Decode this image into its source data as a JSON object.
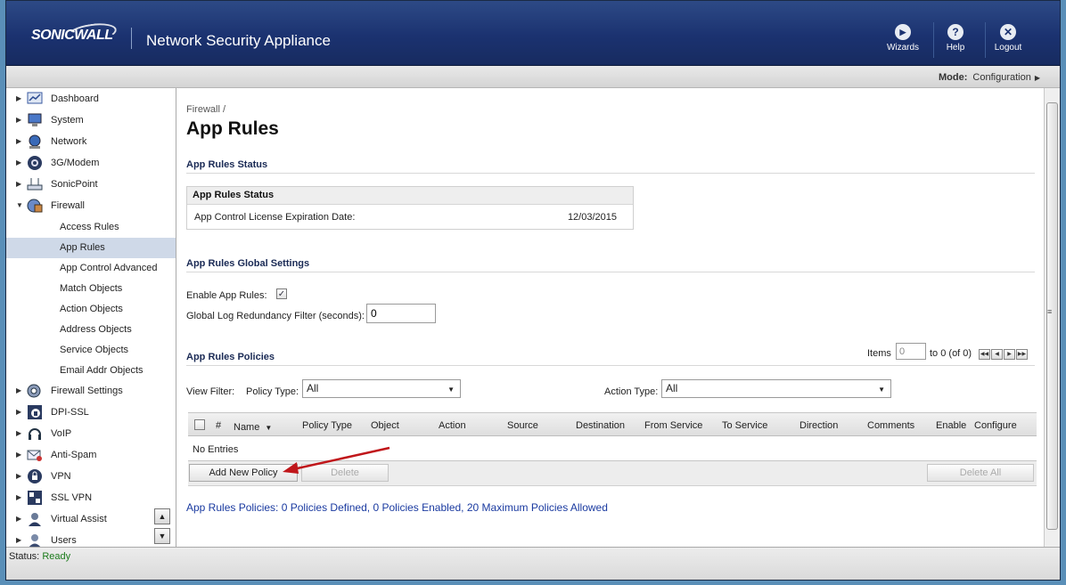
{
  "header": {
    "logo": "SONICWALL",
    "app_title": "Network Security Appliance",
    "buttons": [
      {
        "label": "Wizards",
        "icon": "wizard-icon",
        "glyph": "▶"
      },
      {
        "label": "Help",
        "icon": "help-icon",
        "glyph": "?"
      },
      {
        "label": "Logout",
        "icon": "logout-icon",
        "glyph": "✕"
      }
    ]
  },
  "modebar": {
    "label": "Mode:",
    "value": "Configuration"
  },
  "sidebar": {
    "items": [
      {
        "label": "Dashboard",
        "icon": "dashboard-icon"
      },
      {
        "label": "System",
        "icon": "system-icon"
      },
      {
        "label": "Network",
        "icon": "network-icon"
      },
      {
        "label": "3G/Modem",
        "icon": "modem-icon"
      },
      {
        "label": "SonicPoint",
        "icon": "sonicpoint-icon"
      },
      {
        "label": "Firewall",
        "icon": "firewall-icon"
      },
      {
        "label": "Access Rules"
      },
      {
        "label": "App Rules"
      },
      {
        "label": "App Control Advanced"
      },
      {
        "label": "Match Objects"
      },
      {
        "label": "Action Objects"
      },
      {
        "label": "Address Objects"
      },
      {
        "label": "Service Objects"
      },
      {
        "label": "Email Addr Objects"
      },
      {
        "label": "Firewall Settings",
        "icon": "firewall-settings-icon"
      },
      {
        "label": "DPI-SSL",
        "icon": "dpi-ssl-icon"
      },
      {
        "label": "VoIP",
        "icon": "voip-icon"
      },
      {
        "label": "Anti-Spam",
        "icon": "anti-spam-icon"
      },
      {
        "label": "VPN",
        "icon": "vpn-icon"
      },
      {
        "label": "SSL VPN",
        "icon": "ssl-vpn-icon"
      },
      {
        "label": "Virtual Assist",
        "icon": "virtual-assist-icon"
      },
      {
        "label": "Users",
        "icon": "users-icon"
      }
    ]
  },
  "main": {
    "breadcrumb": "Firewall /",
    "title": "App Rules",
    "status_section": "App Rules Status",
    "status_box": {
      "header": "App Rules Status",
      "label": "App Control License Expiration Date:",
      "value": "12/03/2015"
    },
    "global_section": "App Rules Global Settings",
    "enable_label": "Enable App Rules:",
    "enable_checked": true,
    "log_label": "Global Log Redundancy Filter (seconds):",
    "log_value": "0",
    "policies_section": "App Rules Policies",
    "items_label": "Items",
    "items_value": "0",
    "items_range": "to 0 (of 0)",
    "view_filter_label": "View Filter:",
    "policy_type_label": "Policy Type:",
    "policy_type_value": "All",
    "action_type_label": "Action Type:",
    "action_type_value": "All",
    "columns": [
      "#",
      "Name",
      "Policy Type",
      "Object",
      "Action",
      "Source",
      "Destination",
      "From Service",
      "To Service",
      "Direction",
      "Comments",
      "Enable",
      "Configure"
    ],
    "empty_text": "No Entries",
    "add_button": "Add New Policy",
    "delete_button": "Delete",
    "delete_all_button": "Delete All",
    "summary": "App Rules Policies:  0 Policies Defined, 0 Policies Enabled, 20 Maximum Policies Allowed"
  },
  "statusbar": {
    "label": "Status:",
    "value": "Ready"
  },
  "colors": {
    "header": "#1b3270",
    "link": "#1a3aa0",
    "arrow": "#c0161a"
  }
}
